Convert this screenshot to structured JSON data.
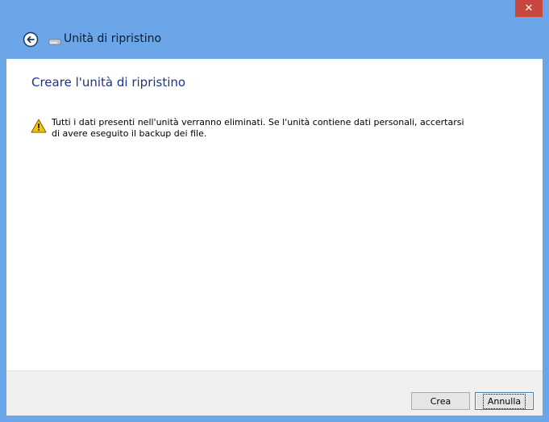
{
  "window": {
    "title": "Unità di ripristino",
    "close_glyph": "✕"
  },
  "content": {
    "heading": "Creare l'unità di ripristino",
    "warning_line1": "Tutti i dati presenti nell'unità verranno eliminati. Se l'unità contiene dati personali, accertarsi",
    "warning_line2": "di avere eseguito il backup dei file."
  },
  "footer": {
    "create_label": "Crea",
    "cancel_label": "Annulla"
  },
  "icons": {
    "back": "back-arrow-icon",
    "drive": "drive-icon",
    "warning": "warning-icon",
    "close": "close-icon"
  },
  "colors": {
    "frame": "#6ba6e8",
    "close": "#c7463e",
    "heading": "#1e3287",
    "footer": "#f0f0f0"
  }
}
